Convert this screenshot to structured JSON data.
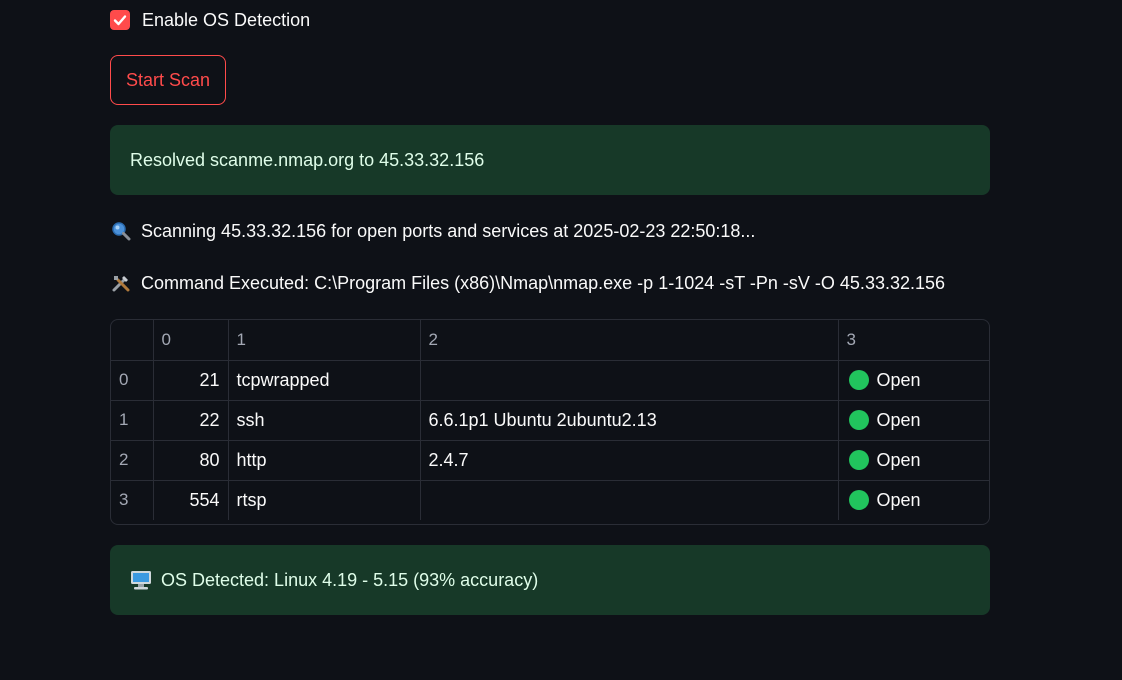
{
  "os_detection": {
    "label": "Enable OS Detection",
    "checked": true
  },
  "start_button": {
    "label": "Start Scan"
  },
  "resolved_alert": {
    "text": "Resolved scanme.nmap.org to 45.33.32.156"
  },
  "scan_status": {
    "icon": "magnifier-icon",
    "text": "Scanning 45.33.32.156 for open ports and services at 2025-02-23 22:50:18..."
  },
  "command": {
    "icon": "tools-icon",
    "text": "Command Executed: C:\\Program Files (x86)\\Nmap\\nmap.exe -p 1-1024 -sT -Pn -sV -O 45.33.32.156"
  },
  "results_table": {
    "headers": [
      "",
      "0",
      "1",
      "2",
      "3"
    ],
    "rows": [
      {
        "index": "0",
        "port": "21",
        "service": "tcpwrapped",
        "version": "",
        "status": "Open"
      },
      {
        "index": "1",
        "port": "22",
        "service": "ssh",
        "version": "6.6.1p1 Ubuntu 2ubuntu2.13",
        "status": "Open"
      },
      {
        "index": "2",
        "port": "80",
        "service": "http",
        "version": "2.4.7",
        "status": "Open"
      },
      {
        "index": "3",
        "port": "554",
        "service": "rtsp",
        "version": "",
        "status": "Open"
      }
    ]
  },
  "os_alert": {
    "icon": "computer-icon",
    "text": "OS Detected: Linux 4.19 - 5.15 (93% accuracy)"
  },
  "colors": {
    "background": "#0e1117",
    "accent": "#ff4b4b",
    "success_bg": "#173928",
    "status_open": "#21c45d"
  }
}
